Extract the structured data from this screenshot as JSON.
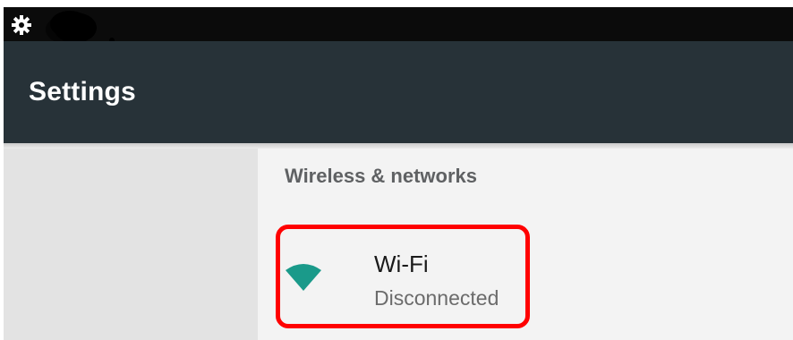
{
  "app_bar": {
    "title": "Settings"
  },
  "status_bar": {
    "icon": "gear-icon"
  },
  "content": {
    "section_header": "Wireless & networks",
    "wifi": {
      "title": "Wi-Fi",
      "summary": "Disconnected",
      "icon": "wifi-icon",
      "icon_color": "#1a9a8a"
    }
  },
  "highlight": {
    "color": "#ff0000"
  }
}
